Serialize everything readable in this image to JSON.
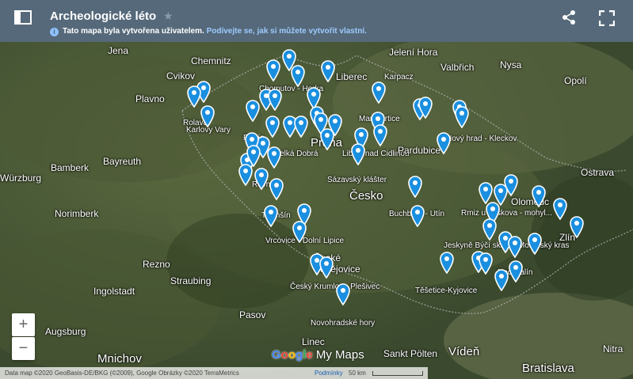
{
  "header": {
    "title": "Archeologické léto",
    "info_text": "Tato mapa byla vytvořena uživatelem.",
    "info_link": "Podívejte se, jak si můžete vytvořit vlastní."
  },
  "map_labels": [
    {
      "text": "Jena"
    },
    {
      "text": "Chemnitz"
    },
    {
      "text": "Cvikov"
    },
    {
      "text": "Liberec"
    },
    {
      "text": "Jelení Hora"
    },
    {
      "text": "Valbřich"
    },
    {
      "text": "Karpacz"
    },
    {
      "text": "Nysa"
    },
    {
      "text": "Opolí"
    },
    {
      "text": "Plavno"
    },
    {
      "text": "Chomutov - Horka"
    },
    {
      "text": "Rolava"
    },
    {
      "text": "Karlovy Vary"
    },
    {
      "text": "Markvartice"
    },
    {
      "text": "Nový hrad - Kleckov"
    },
    {
      "text": "Rubín"
    },
    {
      "text": "Velká Dobrá"
    },
    {
      "text": "Praha"
    },
    {
      "text": "Libice nad Cidlinou"
    },
    {
      "text": "Pardubice"
    },
    {
      "text": "Bamberk"
    },
    {
      "text": "Bayreuth"
    },
    {
      "text": "Sázavský klášter"
    },
    {
      "text": "Ostrava"
    },
    {
      "text": "Würzburg"
    },
    {
      "text": "Rovný"
    },
    {
      "text": "Česko"
    },
    {
      "text": "Olomouc"
    },
    {
      "text": "Norimberk"
    },
    {
      "text": "Třemšín"
    },
    {
      "text": "Buchberg - Utín"
    },
    {
      "text": "Rmiz u Laškova - mohyl..."
    },
    {
      "text": "Zlín"
    },
    {
      "text": "Vrcovice - Dolní Lipice"
    },
    {
      "text": "České Budějovice"
    },
    {
      "text": "Jeskyně Býčí skála - Moravský kras"
    },
    {
      "text": "Rezno"
    },
    {
      "text": "Nechvalín"
    },
    {
      "text": "Ingolstadt"
    },
    {
      "text": "Straubing"
    },
    {
      "text": "Český Krumlov - Plešivec"
    },
    {
      "text": "Těšetice-Kyjovice"
    },
    {
      "text": "Pasov"
    },
    {
      "text": "Novohradské hory"
    },
    {
      "text": "Augsburg"
    },
    {
      "text": "Linec"
    },
    {
      "text": "Sankt Pölten"
    },
    {
      "text": "Vídeň"
    },
    {
      "text": "Mnichov"
    },
    {
      "text": "Bratislava"
    },
    {
      "text": "Nitra"
    }
  ],
  "zoom": {
    "in": "+",
    "out": "−"
  },
  "brand": {
    "g1": "G",
    "g2": "o",
    "g3": "o",
    "g4": "g",
    "g5": "l",
    "g6": "e",
    "mymaps": " My Maps"
  },
  "footer": {
    "attribution": "Data map ©2020 GeoBasis-DE/BKG (©2009), Google Obrázky ©2020 TerraMetrics",
    "terms": "Podmínky",
    "scale": "50 km"
  },
  "colors": {
    "header": "#55697a",
    "pin": "#1a8fe0",
    "link": "#9ecbff"
  }
}
